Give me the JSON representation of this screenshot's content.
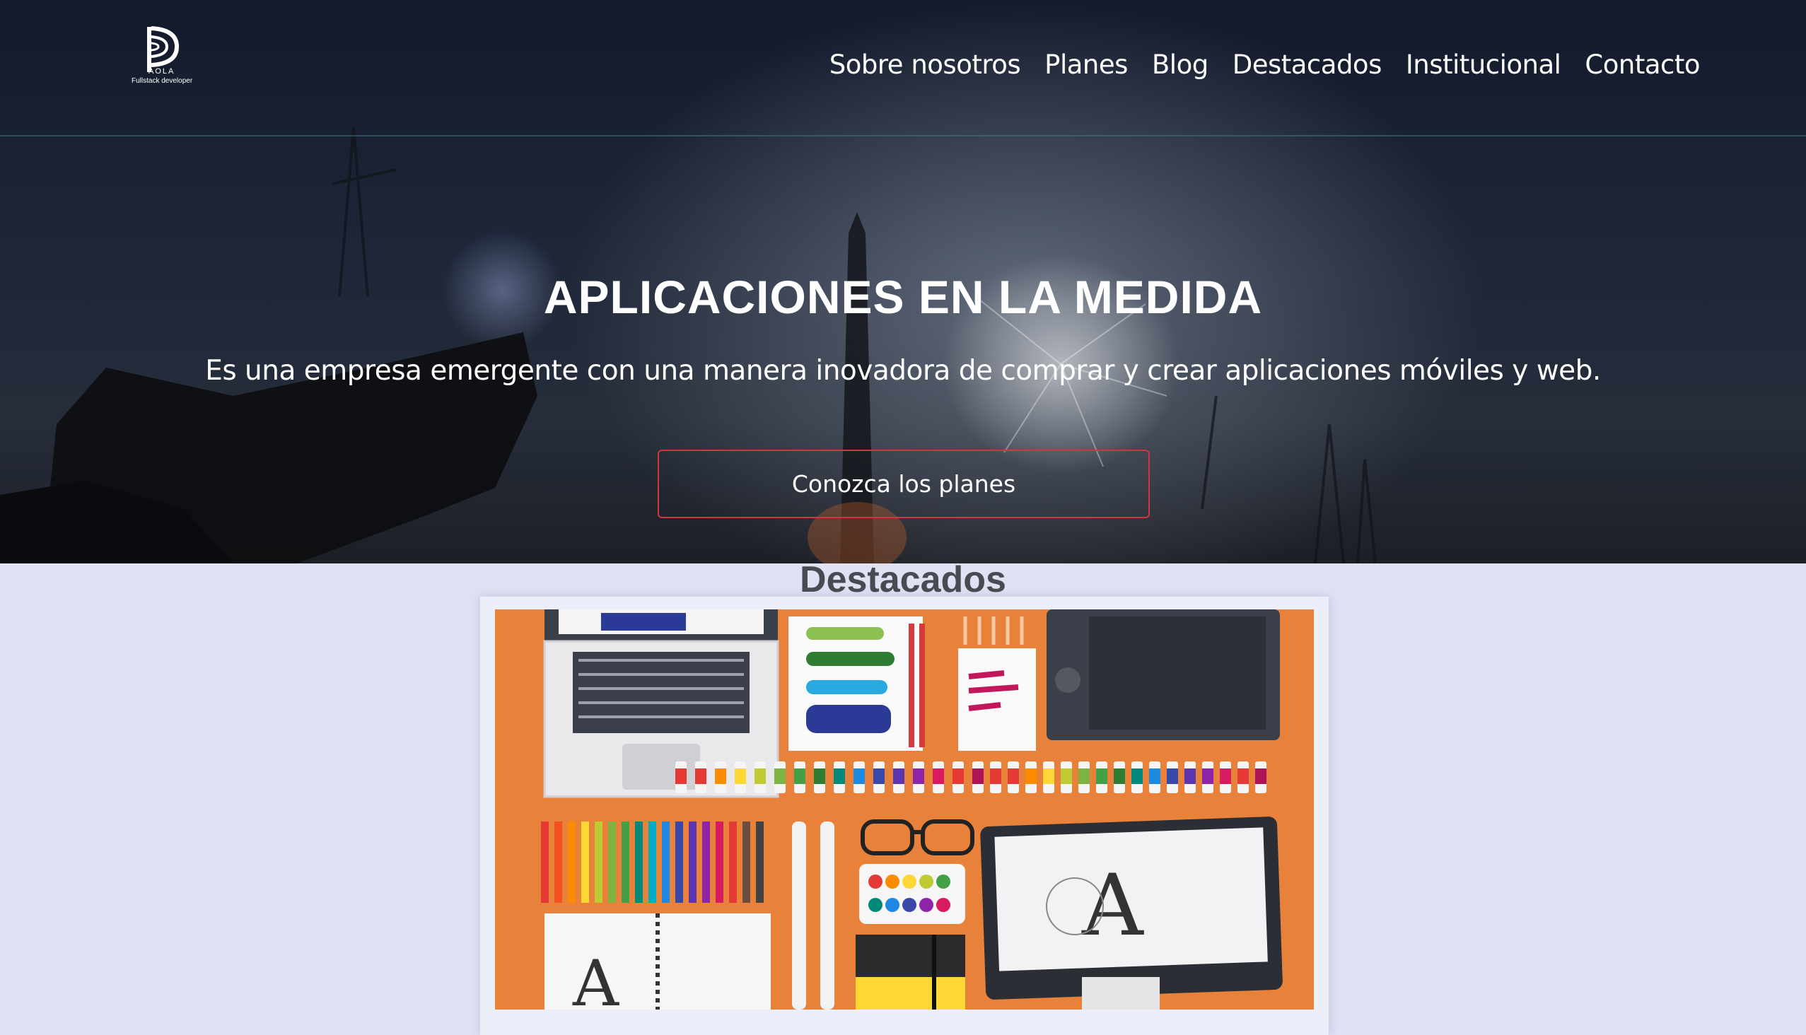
{
  "logo": {
    "letters": "AOLA",
    "tagline": "Fullstack developer"
  },
  "nav": [
    {
      "label": "Sobre nosotros"
    },
    {
      "label": "Planes"
    },
    {
      "label": "Blog"
    },
    {
      "label": "Destacados"
    },
    {
      "label": "Institucional"
    },
    {
      "label": "Contacto"
    }
  ],
  "hero": {
    "title": "APLICACIONES EN LA MEDIDA",
    "subtitle": "Es una empresa emergente con una manera inovadora de comprar y crear aplicaciones móviles y web.",
    "cta_label": "Conozca los planes"
  },
  "featured": {
    "title": "Destacados",
    "image_icon": "designer-desk-illustration"
  },
  "colors": {
    "cta_border": "#d2353f",
    "section_bg": "#e0e2f4",
    "desk_orange": "#e8823a"
  }
}
